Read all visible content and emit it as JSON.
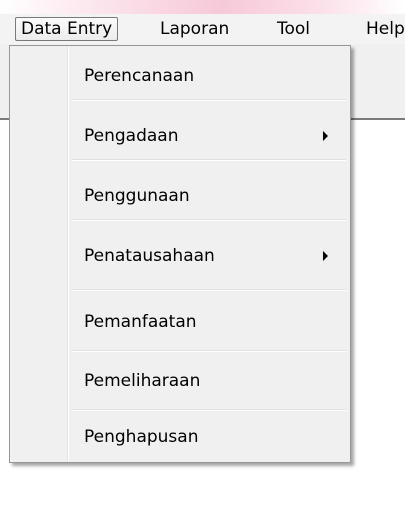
{
  "menubar": {
    "items": [
      {
        "label": "Data Entry"
      },
      {
        "label": "Laporan"
      },
      {
        "label": "Tool"
      },
      {
        "label": "Help"
      }
    ]
  },
  "dropdown": {
    "items": [
      {
        "label": "Perencanaan",
        "has_submenu": false
      },
      {
        "label": "Pengadaan",
        "has_submenu": true
      },
      {
        "label": "Penggunaan",
        "has_submenu": false
      },
      {
        "label": "Penatausahaan",
        "has_submenu": true
      },
      {
        "label": "Pemanfaatan",
        "has_submenu": false
      },
      {
        "label": "Pemeliharaan",
        "has_submenu": false
      },
      {
        "label": "Penghapusan",
        "has_submenu": false
      }
    ]
  }
}
